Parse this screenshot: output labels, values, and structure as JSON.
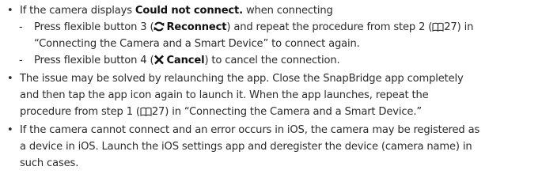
{
  "items": [
    {
      "lead": "If the camera displays ",
      "bold": "Could not connect.",
      "tail": " when connecting",
      "subitems": [
        {
          "pre": "Press flexible button 3 (",
          "button_label": "Reconnect",
          "icon": "reconnect-icon",
          "mid": ") and repeat the procedure from step 2 (",
          "page_ref": "27",
          "post_line1": ") in",
          "line2": "“Connecting the Camera and a Smart Device” to connect again."
        },
        {
          "pre": "Press flexible button 4 (",
          "button_label": "Cancel",
          "icon": "cancel-icon",
          "post": ") to cancel the connection."
        }
      ]
    },
    {
      "line1": "The issue may be solved by relaunching the app. Close the SnapBridge app completely",
      "line2": "and then tap the app icon again to launch it. When the app launches, repeat the",
      "line3_pre": "procedure from step 1 (",
      "page_ref": "27",
      "line3_post": ") in “Connecting the Camera and a Smart Device.”"
    },
    {
      "line1": "If the camera cannot connect and an error occurs in iOS, the camera may be registered as",
      "line2": "a device in iOS. Launch the iOS settings app and deregister the device (camera name) in",
      "line3": "such cases."
    }
  ],
  "icons": {
    "reference_icon": "book-icon",
    "reconnect_icon": "circular-arrows-icon",
    "cancel_icon": "x-icon"
  }
}
